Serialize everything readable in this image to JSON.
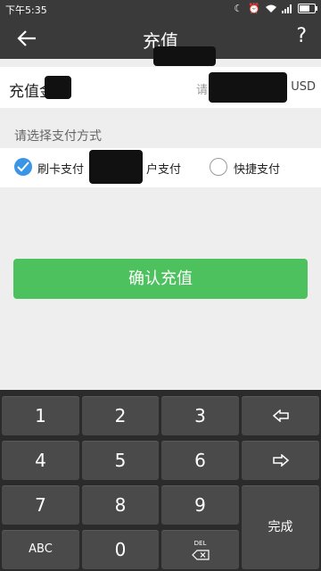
{
  "status_bar": {
    "time": "下午5:35",
    "battery_level": 0.7
  },
  "app_bar": {
    "title": "充值",
    "help": "?"
  },
  "amount": {
    "label": "充值金额",
    "placeholder": "请",
    "currency": "USD"
  },
  "payment": {
    "section_label": "请选择支付方式",
    "options": [
      {
        "label": "刷卡支付",
        "selected": true
      },
      {
        "label": "户支付",
        "selected": false
      },
      {
        "label": "快捷支付",
        "selected": false
      }
    ]
  },
  "confirm_button": "确认充值",
  "keypad": {
    "keys": [
      "1",
      "2",
      "3",
      "4",
      "5",
      "6",
      "7",
      "8",
      "9",
      "ABC",
      "0"
    ],
    "del_label": "DEL",
    "done_label": "完成"
  }
}
